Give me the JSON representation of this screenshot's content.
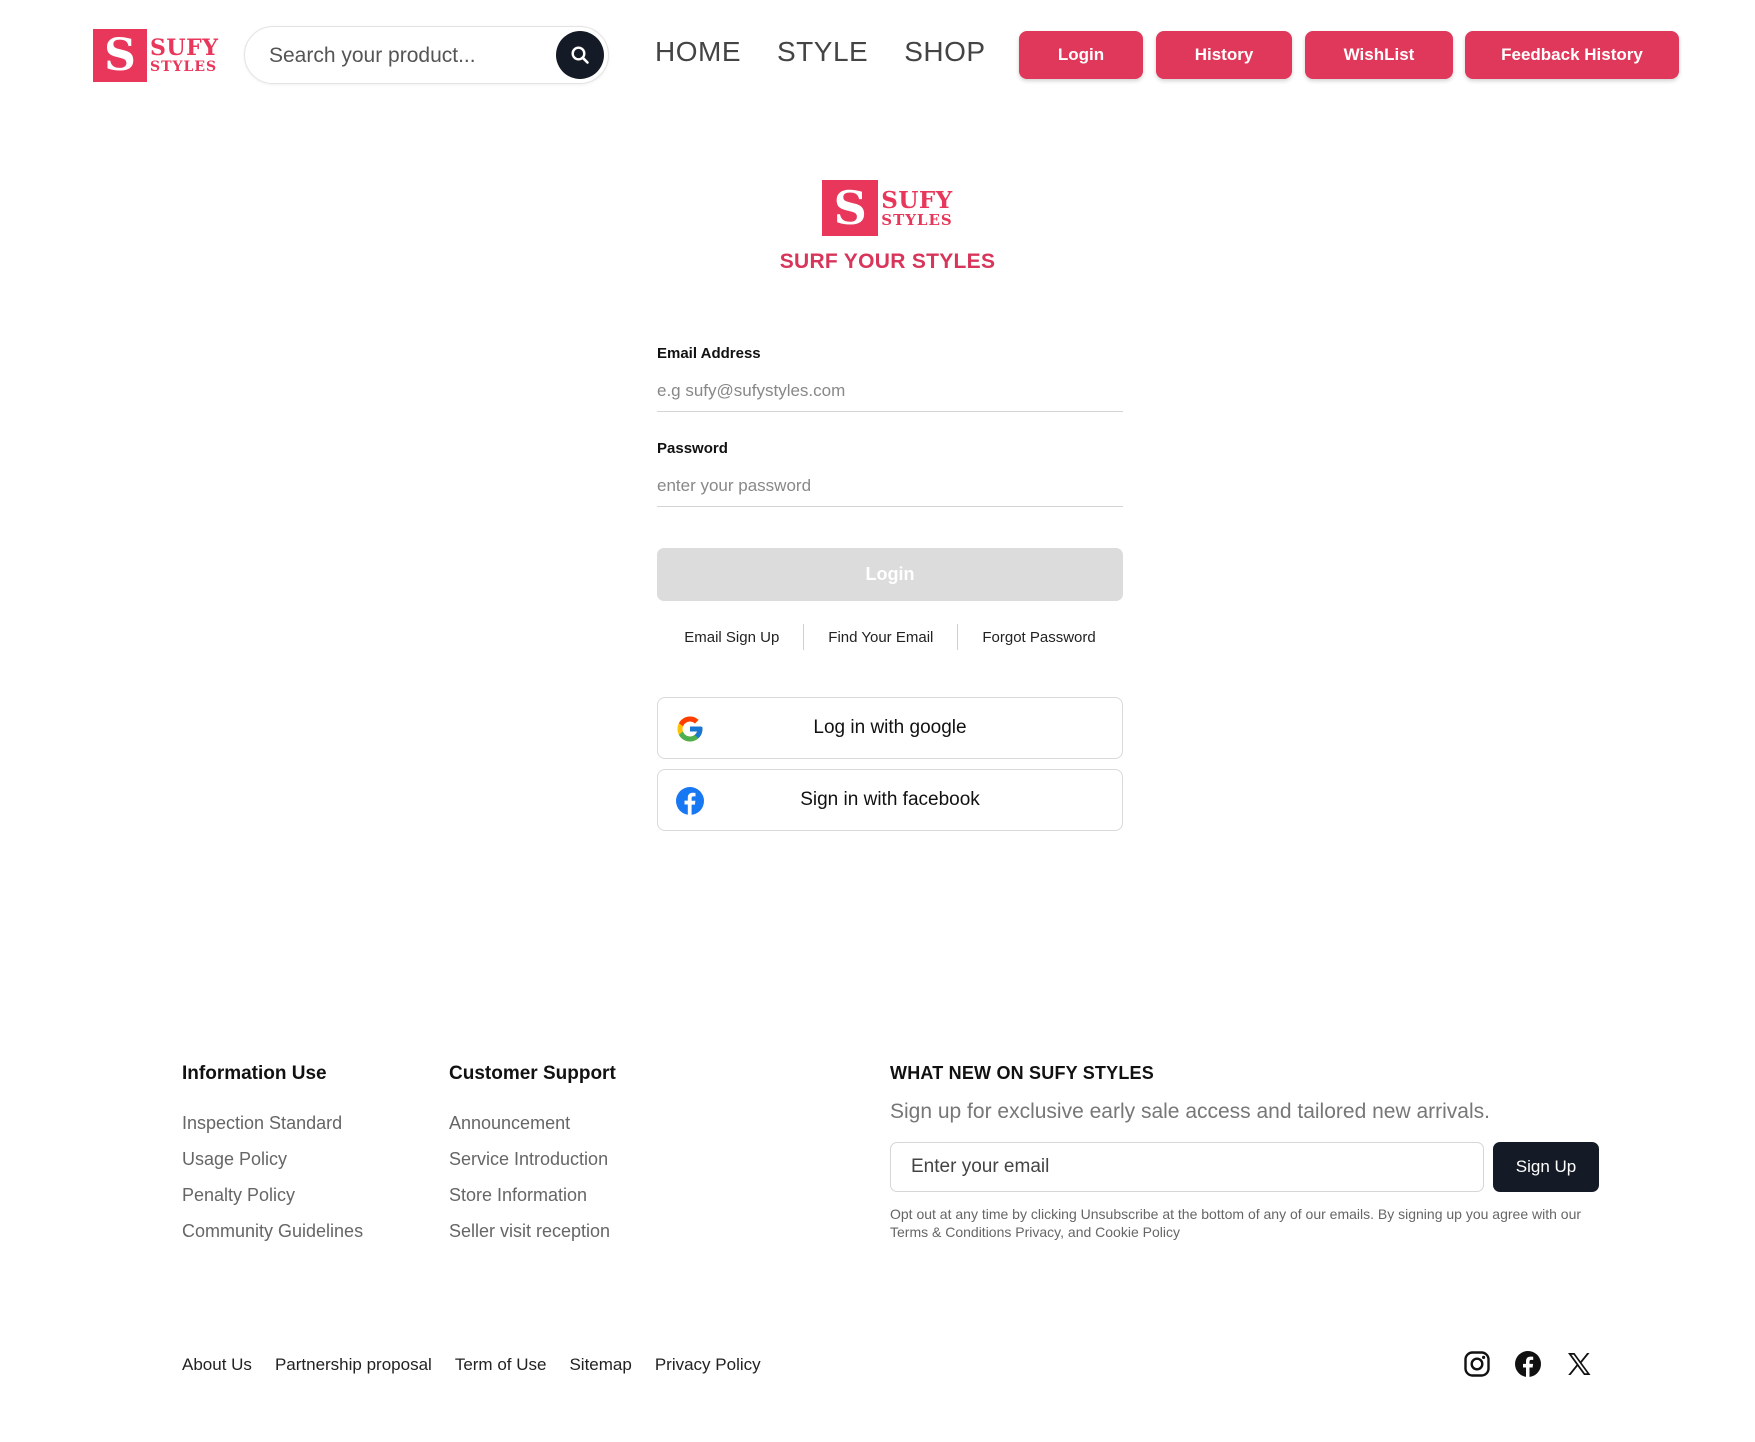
{
  "header": {
    "logo": {
      "mark": "S",
      "word1": "SUFY",
      "word2": "STYLES"
    },
    "search": {
      "placeholder": "Search your product..."
    },
    "nav": [
      "HOME",
      "STYLE",
      "SHOP"
    ],
    "buttons": [
      "Login",
      "History",
      "WishList",
      "Feedback History"
    ]
  },
  "brand": {
    "logo": {
      "mark": "S",
      "word1": "SUFY",
      "word2": "STYLES"
    },
    "tagline": "SURF YOUR STYLES"
  },
  "form": {
    "email_label": "Email Address",
    "email_placeholder": "e.g sufy@sufystyles.com",
    "password_label": "Password",
    "password_placeholder": "enter your password",
    "login_label": "Login",
    "links": [
      "Email Sign Up",
      "Find Your Email",
      "Forgot Password"
    ],
    "google_label": "Log in with google",
    "facebook_label": "Sign in with facebook"
  },
  "footer": {
    "col1": {
      "title": "Information Use",
      "items": [
        "Inspection Standard",
        "Usage Policy",
        "Penalty Policy",
        "Community Guidelines"
      ]
    },
    "col2": {
      "title": "Customer Support",
      "items": [
        "Announcement",
        "Service Introduction",
        "Store Information",
        "Seller visit reception"
      ]
    },
    "news": {
      "title": "WHAT NEW ON SUFY STYLES",
      "subtitle": "Sign up for exclusive early sale access and tailored new arrivals.",
      "email_placeholder": "Enter your email",
      "signup_label": "Sign Up",
      "disclaimer": "Opt out at any time by clicking Unsubscribe at the bottom of any of our emails. By signing up you agree with our Terms & Conditions Privacy, and Cookie Policy"
    },
    "bottom_links": [
      "About Us",
      "Partnership proposal",
      "Term of Use",
      "Sitemap",
      "Privacy Policy"
    ],
    "socials": [
      "instagram-icon",
      "facebook-icon",
      "x-icon"
    ]
  },
  "colors": {
    "brand": "#e8375a",
    "dark": "#151b26",
    "disabled": "#dcdcdc"
  }
}
